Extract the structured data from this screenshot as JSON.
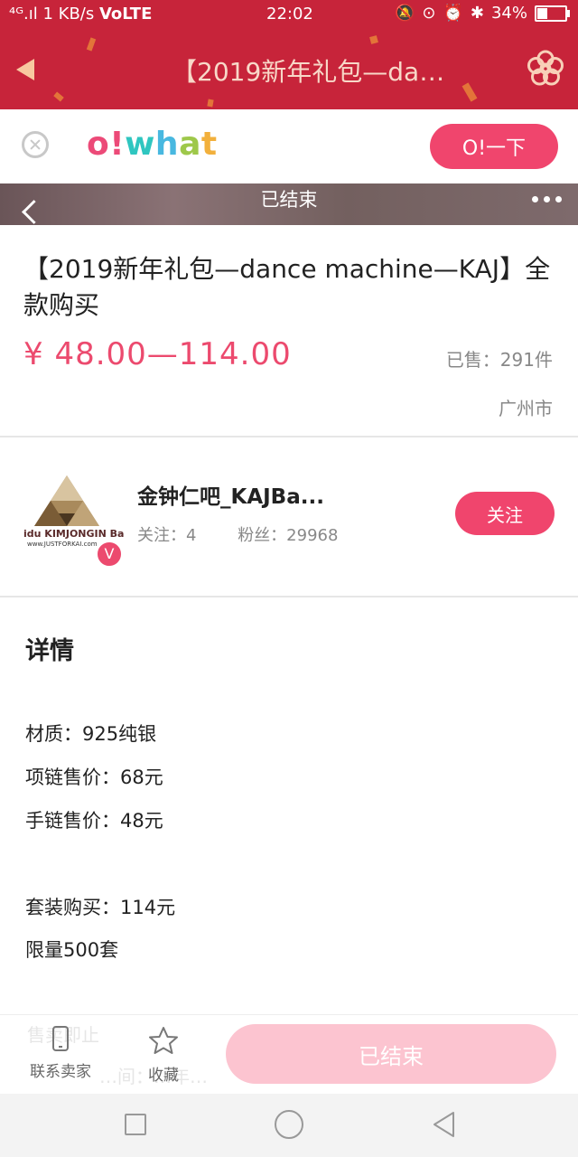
{
  "status_bar": {
    "signal": "⁴ᴳ.ıl",
    "speed": "1 KB/s",
    "network": "VoLTE",
    "time": "22:02",
    "battery": "34%",
    "battery_level": 0.34
  },
  "header": {
    "title": "【2019新年礼包—da…",
    "bg_color": "#c7243a"
  },
  "app_banner": {
    "logo": "o!what",
    "open_button": "O!一下"
  },
  "image_strip": {
    "status_text": "已结束"
  },
  "product": {
    "title": "【2019新年礼包—dance machine—KAJ】全款购买",
    "price": "¥ 48.00—114.00",
    "sold": "已售：291件",
    "location": "广州市"
  },
  "seller": {
    "avatar_caption": "idu KIMJONGIN Ba",
    "avatar_url": "www.JUSTFORKAI.com",
    "verified_badge": "V",
    "name": "金钟仁吧_KAJBa...",
    "following": "关注：4",
    "followers": "粉丝：29968",
    "follow_button": "关注"
  },
  "details": {
    "heading": "详情",
    "lines": [
      "材质：925纯银",
      "项链售价：68元",
      "手链售价：48元",
      "套装购买：114元",
      "限量500套"
    ],
    "partially_hidden": [
      "售卖即止",
      "…间：…年…"
    ]
  },
  "action_bar": {
    "contact_seller": "联系卖家",
    "favorite": "收藏",
    "ended_button": "已结束"
  },
  "colors": {
    "accent": "#f0456d",
    "price": "#ec4a6e",
    "ended_button": "#fcc4d0"
  }
}
